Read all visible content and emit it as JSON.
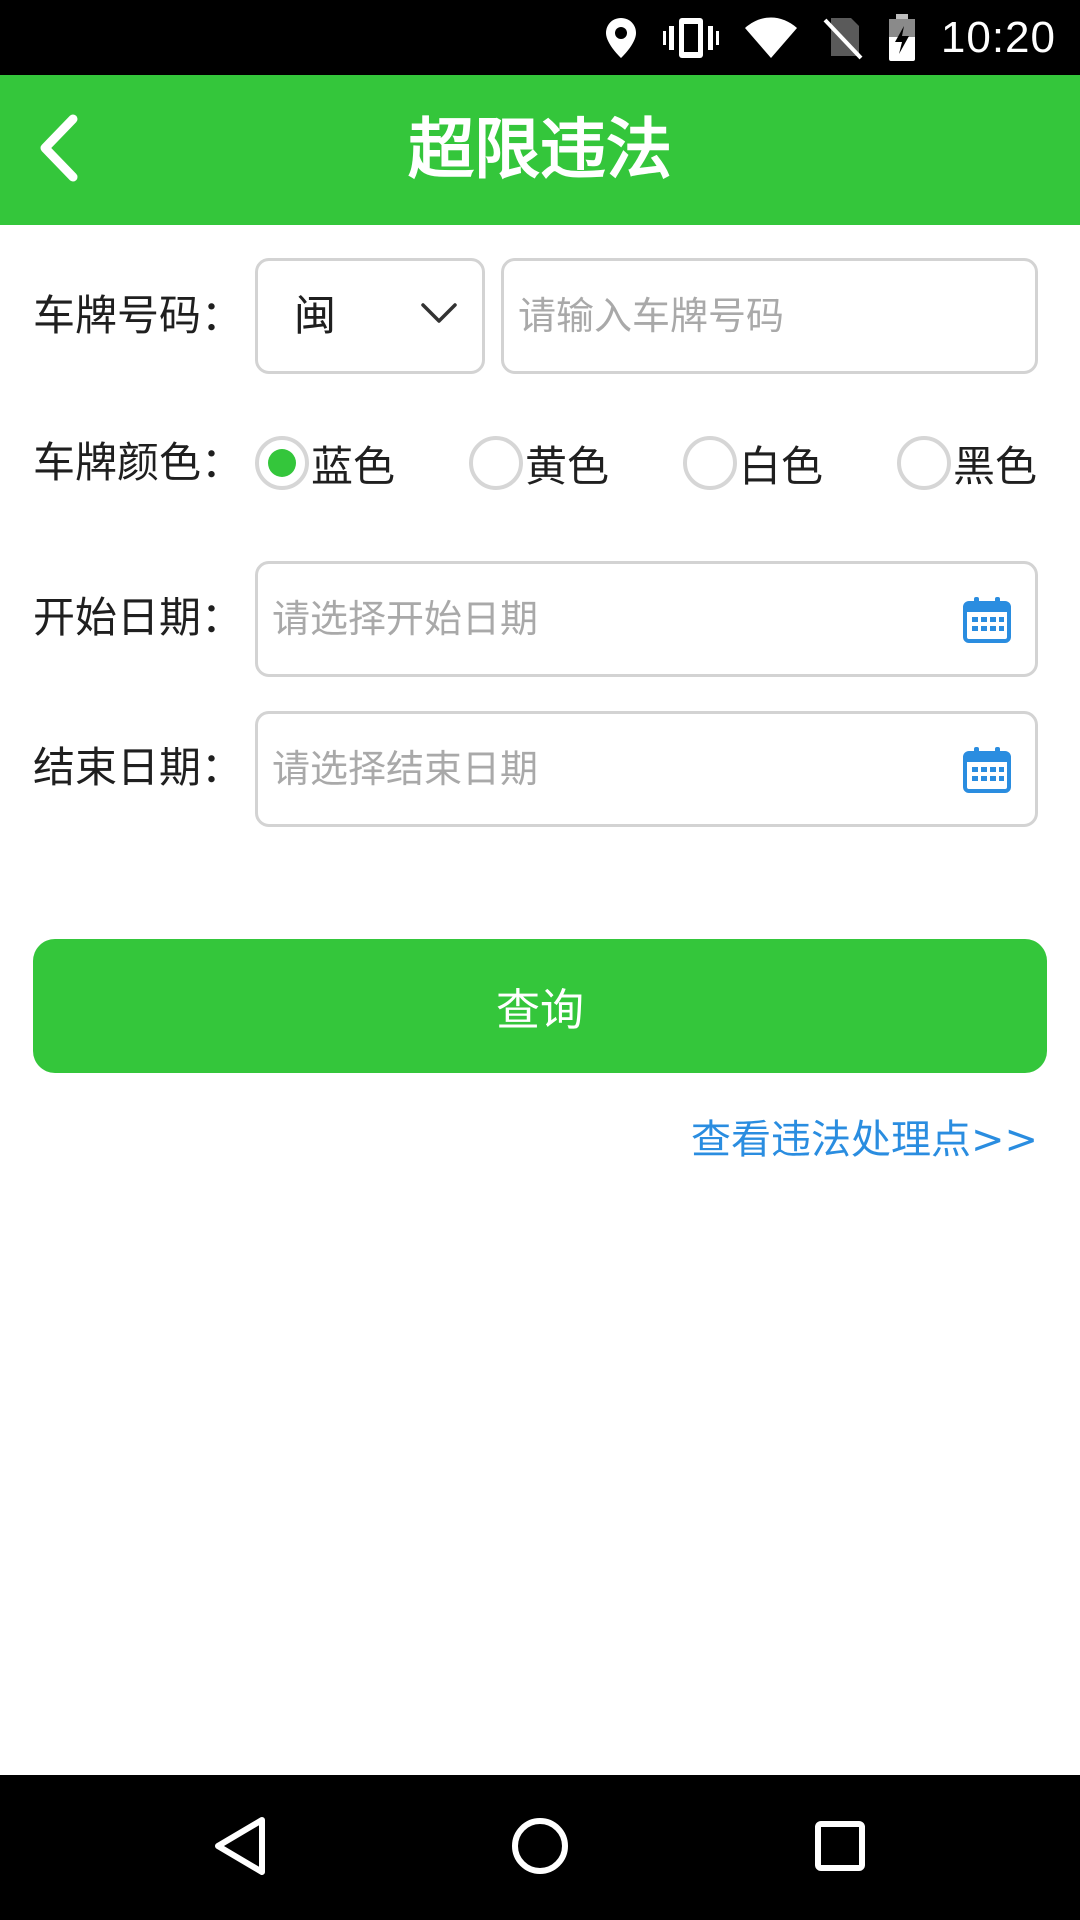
{
  "status_bar": {
    "time": "10:20",
    "icons": [
      "location-icon",
      "vibrate-icon",
      "wifi-icon",
      "no-sim-icon",
      "battery-charging-icon"
    ]
  },
  "app_bar": {
    "title": "超限违法",
    "back_icon": "chevron-left-icon"
  },
  "form": {
    "plate_number": {
      "label": "车牌号码：",
      "province_value": "闽",
      "input_placeholder": "请输入车牌号码"
    },
    "plate_color": {
      "label": "车牌颜色：",
      "options": [
        {
          "label": "蓝色",
          "selected": true
        },
        {
          "label": "黄色",
          "selected": false
        },
        {
          "label": "白色",
          "selected": false
        },
        {
          "label": "黑色",
          "selected": false
        }
      ]
    },
    "start_date": {
      "label": "开始日期：",
      "placeholder": "请选择开始日期",
      "icon": "calendar-icon"
    },
    "end_date": {
      "label": "结束日期：",
      "placeholder": "请选择结束日期",
      "icon": "calendar-icon"
    }
  },
  "query_button": {
    "label": "查询"
  },
  "view_link": {
    "label": "查看违法处理点>>"
  },
  "nav_bar": {
    "icons": [
      "back-triangle-icon",
      "home-circle-icon",
      "recents-square-icon"
    ]
  },
  "colors": {
    "accent_green": "#34c63b",
    "link_blue": "#2a8de0",
    "placeholder_gray": "#a9a9a9",
    "border_gray": "#d3d3d3"
  }
}
